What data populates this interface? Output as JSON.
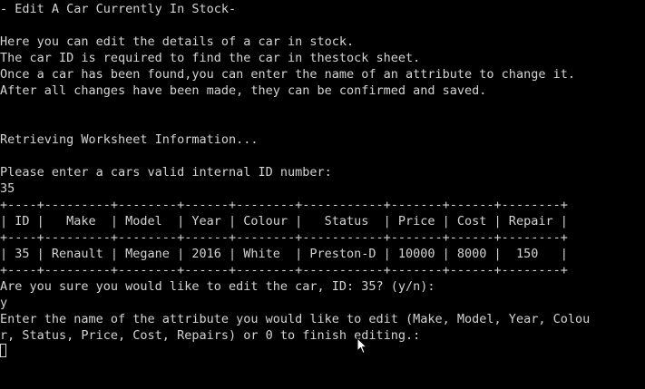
{
  "terminal": {
    "lines": [
      "- Edit A Car Currently In Stock-",
      "",
      "Here you can edit the details of a car in stock.",
      "The car ID is required to find the car in thestock sheet.",
      "Once a car has been found,you can enter the name of an attribute to change it.",
      "After all changes have been made, they can be confirmed and saved.",
      "",
      "",
      "Retrieving Worksheet Information...",
      "",
      "Please enter a cars valid internal ID number:",
      "35",
      "+----+---------+--------+------+--------+-----------+-------+------+--------+",
      "| ID |   Make  | Model  | Year | Colour |   Status  | Price | Cost | Repair |",
      "+----+---------+--------+------+--------+-----------+-------+------+--------+",
      "| 35 | Renault | Megane | 2016 | White  | Preston-D | 10000 | 8000 |  150   |",
      "+----+---------+--------+------+--------+-----------+-------+------+--------+",
      "Are you sure you would like to edit the car, ID: 35? (y/n):",
      "y",
      "Enter the name of the attribute you would like to edit (Make, Model, Year, Colou",
      "r, Status, Price, Cost, Repairs) or 0 to finish editing.:"
    ]
  },
  "colors": {
    "background": "#000000",
    "foreground": "#d4d4d4"
  },
  "icons": {
    "cursor": "block-cursor-icon",
    "pointer": "mouse-pointer-icon"
  }
}
